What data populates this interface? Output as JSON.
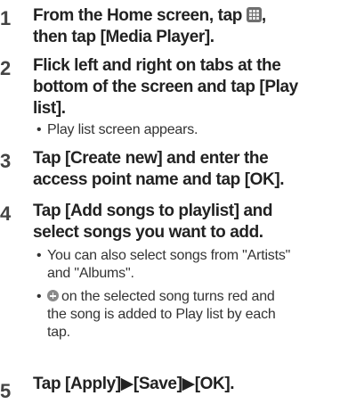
{
  "steps": [
    {
      "number": "1",
      "title_lines": [
        "From the Home screen, tap",
        "then tap [Media Player]."
      ],
      "title_suffix": ","
    },
    {
      "number": "2",
      "title_lines": [
        "Flick left and right on tabs at the",
        "bottom of the screen and tap [Play",
        "list]."
      ],
      "notes": [
        {
          "lines": [
            "Play list screen appears."
          ]
        }
      ]
    },
    {
      "number": "3",
      "title_lines": [
        "Tap [Create new] and enter the",
        "access point name and tap [OK]."
      ]
    },
    {
      "number": "4",
      "title_lines": [
        "Tap [Add songs to playlist] and",
        "select songs you want to add."
      ],
      "notes": [
        {
          "lines": [
            "You can also select songs from \"Artists\"",
            "and \"Albums\"."
          ]
        },
        {
          "lines": [
            "on the selected song turns red and",
            "the song is added to Play list by each",
            "tap."
          ]
        }
      ]
    },
    {
      "number": "5",
      "title_lines": [
        "Tap [Apply]▶[Save]▶[OK]."
      ]
    }
  ],
  "bullet_char": "•",
  "icons": {
    "apps": "apps-grid-icon",
    "add": "add-circle-icon"
  }
}
